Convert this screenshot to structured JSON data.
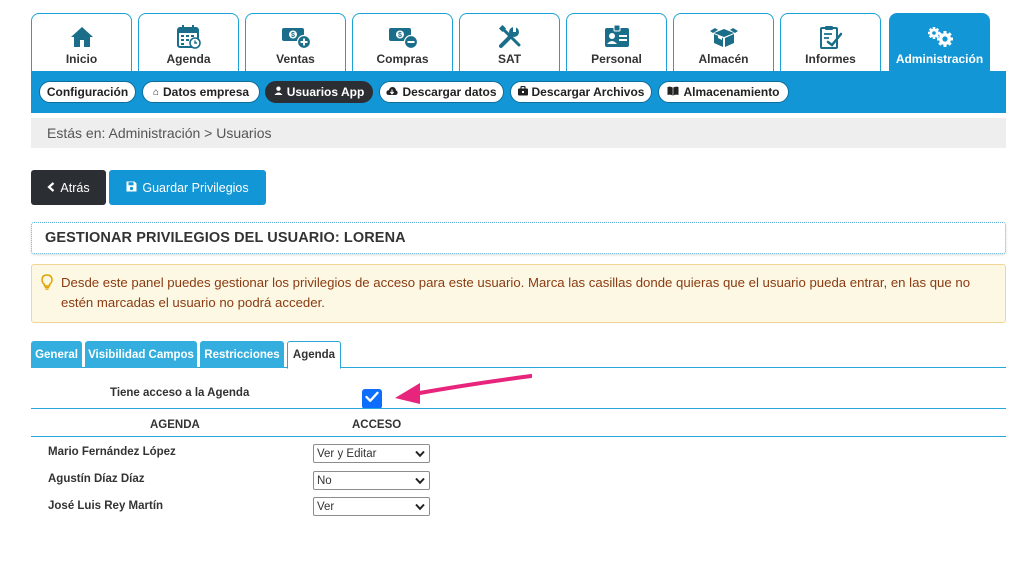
{
  "modules": [
    {
      "label": "Inicio",
      "icon": "home-icon"
    },
    {
      "label": "Agenda",
      "icon": "calendar-icon"
    },
    {
      "label": "Ventas",
      "icon": "cash-plus-icon"
    },
    {
      "label": "Compras",
      "icon": "cash-minus-icon"
    },
    {
      "label": "SAT",
      "icon": "tools-icon"
    },
    {
      "label": "Personal",
      "icon": "id-card-icon"
    },
    {
      "label": "Almacén",
      "icon": "boxes-icon"
    },
    {
      "label": "Informes",
      "icon": "report-icon"
    },
    {
      "label": "Administración",
      "icon": "gears-icon",
      "active": true
    }
  ],
  "subnav": [
    {
      "label": "Configuración",
      "icon": ""
    },
    {
      "label": "Datos empresa",
      "icon": "home-icon"
    },
    {
      "label": "Usuarios App",
      "icon": "user-icon",
      "active": true
    },
    {
      "label": "Descargar datos",
      "icon": "cloud-download-icon"
    },
    {
      "label": "Descargar Archivos",
      "icon": "briefcase-icon"
    },
    {
      "label": "Almacenamiento",
      "icon": "book-icon"
    }
  ],
  "breadcrumb": "Estás en: Administración > Usuarios",
  "buttons": {
    "back": "Atrás",
    "save": "Guardar Privilegios"
  },
  "title": "GESTIONAR PRIVILEGIOS DEL USUARIO: LORENA",
  "alert": "Desde este panel puedes gestionar los privilegios de acceso para este usuario. Marca las casillas donde quieras que el usuario pueda entrar, en las que no estén marcadas el usuario no podrá acceder.",
  "privilege_tabs": [
    {
      "label": "General"
    },
    {
      "label": "Visibilidad Campos"
    },
    {
      "label": "Restricciones"
    },
    {
      "label": "Agenda",
      "active": true
    }
  ],
  "agenda_access": {
    "label": "Tiene acceso a la Agenda",
    "checked": true
  },
  "table": {
    "headers": [
      "AGENDA",
      "ACCESO"
    ],
    "rows": [
      {
        "name": "Mario Fernández López",
        "access": "Ver y Editar"
      },
      {
        "name": "Agustín Díaz Díaz",
        "access": "No"
      },
      {
        "name": "José Luis Rey Martín",
        "access": "Ver"
      }
    ]
  },
  "colors": {
    "primary": "#1396d5",
    "dark": "#2b2f33",
    "alert_bg": "#fcf8e3",
    "alert_text": "#8a3b12",
    "arrow": "#e8257d"
  }
}
